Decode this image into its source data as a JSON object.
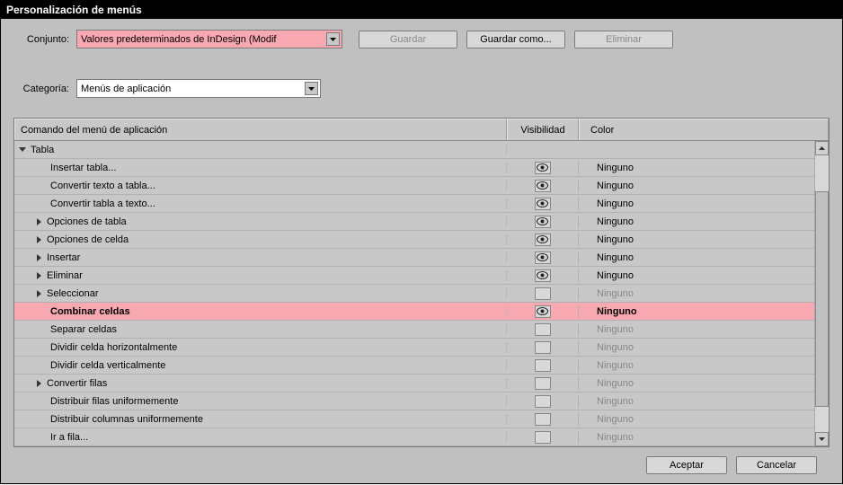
{
  "titlebar": "Personalización de menús",
  "toolbar": {
    "conjunto_label": "Conjunto:",
    "conjunto_value": "Valores predeterminados de InDesign (Modif",
    "guardar": "Guardar",
    "guardar_como": "Guardar como...",
    "eliminar": "Eliminar",
    "categoria_label": "Categoría:",
    "categoria_value": "Menús de aplicación"
  },
  "headers": {
    "cmd": "Comando del menú de aplicación",
    "vis": "Visibilidad",
    "col": "Color"
  },
  "rows": [
    {
      "label": "Tabla",
      "indent": 0,
      "arrow": "down",
      "eye": null,
      "color": null,
      "sel": false
    },
    {
      "label": "Insertar tabla...",
      "indent": 2,
      "arrow": null,
      "eye": true,
      "color": "Ninguno",
      "sel": false,
      "gray": false
    },
    {
      "label": "Convertir texto a tabla...",
      "indent": 2,
      "arrow": null,
      "eye": true,
      "color": "Ninguno",
      "sel": false,
      "gray": false
    },
    {
      "label": "Convertir tabla a texto...",
      "indent": 2,
      "arrow": null,
      "eye": true,
      "color": "Ninguno",
      "sel": false,
      "gray": false
    },
    {
      "label": "Opciones de tabla",
      "indent": 1,
      "arrow": "right",
      "eye": true,
      "color": "Ninguno",
      "sel": false,
      "gray": false
    },
    {
      "label": "Opciones de celda",
      "indent": 1,
      "arrow": "right",
      "eye": true,
      "color": "Ninguno",
      "sel": false,
      "gray": false
    },
    {
      "label": "Insertar",
      "indent": 1,
      "arrow": "right",
      "eye": true,
      "color": "Ninguno",
      "sel": false,
      "gray": false
    },
    {
      "label": "Eliminar",
      "indent": 1,
      "arrow": "right",
      "eye": true,
      "color": "Ninguno",
      "sel": false,
      "gray": false
    },
    {
      "label": "Seleccionar",
      "indent": 1,
      "arrow": "right",
      "eye": false,
      "color": "Ninguno",
      "sel": false,
      "gray": true
    },
    {
      "label": "Combinar celdas",
      "indent": 2,
      "arrow": null,
      "eye": true,
      "color": "Ninguno",
      "sel": true,
      "gray": false
    },
    {
      "label": "Separar celdas",
      "indent": 2,
      "arrow": null,
      "eye": false,
      "color": "Ninguno",
      "sel": false,
      "gray": true
    },
    {
      "label": "Dividir celda horizontalmente",
      "indent": 2,
      "arrow": null,
      "eye": false,
      "color": "Ninguno",
      "sel": false,
      "gray": true
    },
    {
      "label": "Dividir celda verticalmente",
      "indent": 2,
      "arrow": null,
      "eye": false,
      "color": "Ninguno",
      "sel": false,
      "gray": true
    },
    {
      "label": "Convertir filas",
      "indent": 1,
      "arrow": "right",
      "eye": false,
      "color": "Ninguno",
      "sel": false,
      "gray": true
    },
    {
      "label": "Distribuir filas uniformemente",
      "indent": 2,
      "arrow": null,
      "eye": false,
      "color": "Ninguno",
      "sel": false,
      "gray": true
    },
    {
      "label": "Distribuir columnas uniformemente",
      "indent": 2,
      "arrow": null,
      "eye": false,
      "color": "Ninguno",
      "sel": false,
      "gray": true
    },
    {
      "label": "Ir a fila...",
      "indent": 2,
      "arrow": null,
      "eye": false,
      "color": "Ninguno",
      "sel": false,
      "gray": true
    }
  ],
  "footer": {
    "aceptar": "Aceptar",
    "cancelar": "Cancelar"
  }
}
